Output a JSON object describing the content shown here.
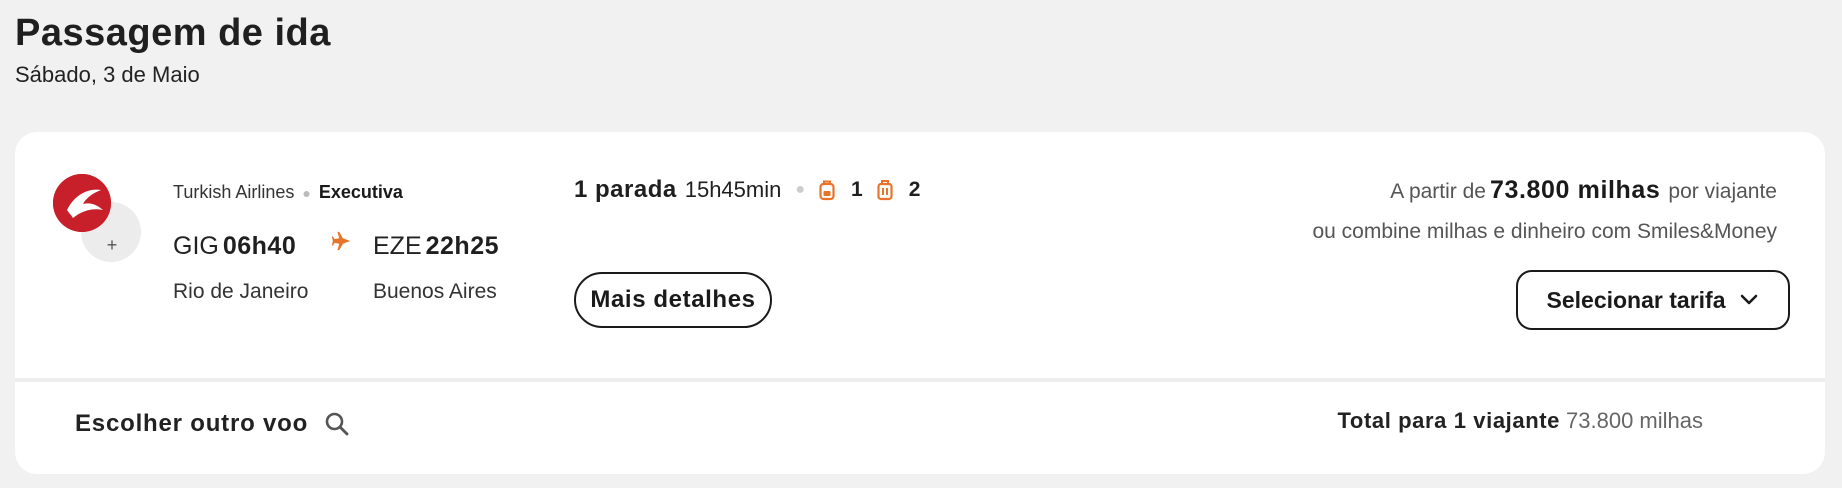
{
  "heading": {
    "title": "Passagem de ida",
    "date": "Sábado, 3 de Maio"
  },
  "flight": {
    "airline": "Turkish Airlines",
    "cabin": "Executiva",
    "logo_plus": "+",
    "departure": {
      "code": "GIG",
      "time": "06h40",
      "city": "Rio de Janeiro"
    },
    "arrival": {
      "code": "EZE",
      "time": "22h25",
      "city": "Buenos Aires"
    },
    "stops": "1 parada",
    "duration": "15h45min",
    "carry_on_count": "1",
    "checked_bag_count": "2",
    "details_button": "Mais detalhes"
  },
  "pricing": {
    "prefix": "A partir de",
    "miles": "73.800 milhas",
    "suffix": "por viajante",
    "combine_text": "ou combine milhas e dinheiro com Smiles&Money",
    "select_button": "Selecionar tarifa"
  },
  "footer": {
    "other_flight": "Escolher outro voo",
    "total_label": "Total para 1 viajante",
    "total_value": "73.800 milhas"
  },
  "colors": {
    "brand_red": "#c8202b",
    "accent_orange": "#e8742a"
  },
  "icons": [
    "turkish-airlines-logo",
    "plus-icon",
    "plane-icon",
    "backpack-icon",
    "suitcase-icon",
    "chevron-down-icon",
    "search-icon"
  ]
}
